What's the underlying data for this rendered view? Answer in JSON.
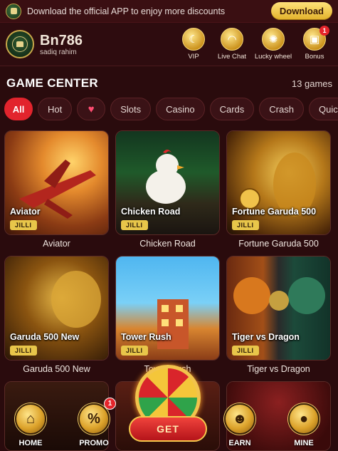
{
  "banner": {
    "message": "Download the official APP to enjoy more discounts",
    "download_label": "Download"
  },
  "header": {
    "brand": "Bn786",
    "username": "sadiq rahim",
    "buttons": [
      {
        "label": "VIP",
        "icon": "crescent-icon"
      },
      {
        "label": "Live Chat",
        "icon": "headset-icon"
      },
      {
        "label": "Lucky wheel",
        "icon": "wheel-icon"
      },
      {
        "label": "Bonus",
        "icon": "gift-icon",
        "badge": "1"
      }
    ]
  },
  "game_center": {
    "title": "GAME CENTER",
    "count": "13 games",
    "tabs": [
      "All",
      "Hot",
      "♥",
      "Slots",
      "Casino",
      "Cards",
      "Crash",
      "Quic"
    ]
  },
  "games": [
    {
      "name": "Aviator",
      "provider": "JILLI",
      "caption": "Aviator"
    },
    {
      "name": "Chicken Road",
      "provider": "JILLI",
      "caption": "Chicken Road"
    },
    {
      "name": "Fortune Garuda 500",
      "provider": "JILLI",
      "caption": "Fortune Garuda 500"
    },
    {
      "name": "Garuda 500 New",
      "provider": "JILLI",
      "caption": "Garuda 500 New"
    },
    {
      "name": "Tower Rush",
      "provider": "JILLI",
      "caption": "Tower Rush"
    },
    {
      "name": "Tiger vs Dragon",
      "provider": "JILLI",
      "caption": "Tiger vs Dragon"
    }
  ],
  "bottom_nav": {
    "home": "HOME",
    "promo": "PROMO",
    "promo_badge": "1",
    "get": "GET",
    "earn": "EARN",
    "mine": "MINE"
  },
  "colors": {
    "accent": "#e2242d",
    "gold": "#e8c64a",
    "background": "#2a0b0d"
  }
}
